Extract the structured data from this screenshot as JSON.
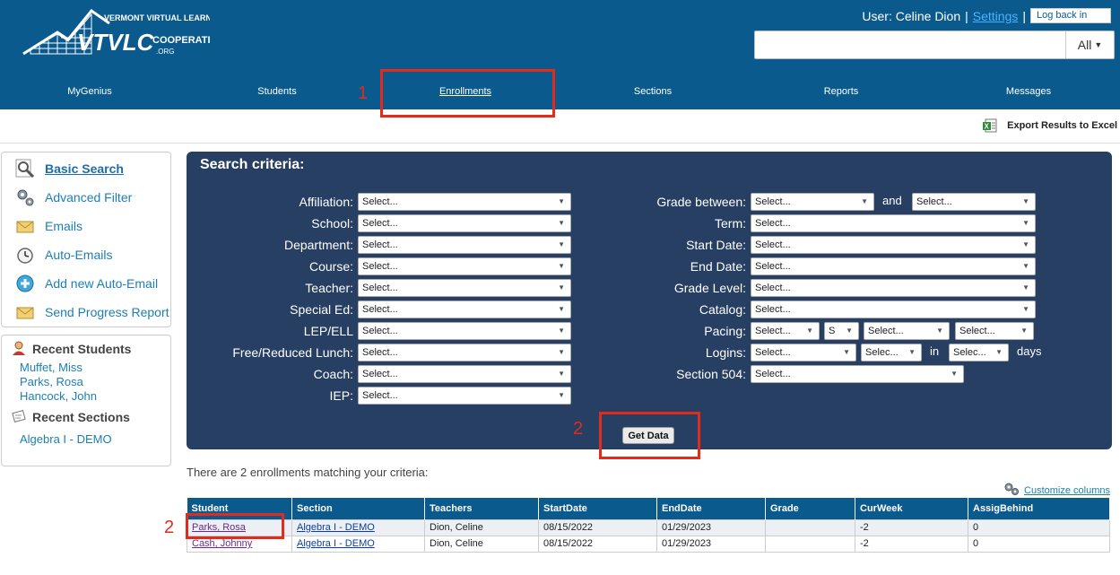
{
  "header": {
    "logo_line1": "VERMONT VIRTUAL LEARNING",
    "logo_main": "VTVLC",
    "logo_line2": "COOPERATIVE",
    "logo_line3": ".ORG",
    "user_text": "User: Celine Dion",
    "sep1": "|",
    "settings_label": "Settings",
    "sep2": "|",
    "log_back_label": "Log back in",
    "search_placeholder": "",
    "search_scope": "All"
  },
  "nav": {
    "items": [
      {
        "label": "MyGenius"
      },
      {
        "label": "Students"
      },
      {
        "label": "Enrollments"
      },
      {
        "label": "Sections"
      },
      {
        "label": "Reports"
      },
      {
        "label": "Messages"
      }
    ]
  },
  "annotations": {
    "one": "1",
    "two_a": "2",
    "two_b": "2"
  },
  "toolbar": {
    "export_label": "Export Results to Excel"
  },
  "sidebar": {
    "menu": [
      {
        "label": "Basic Search",
        "icon": "magnifier-icon"
      },
      {
        "label": "Advanced Filter",
        "icon": "gears-icon"
      },
      {
        "label": "Emails",
        "icon": "envelope-icon"
      },
      {
        "label": "Auto-Emails",
        "icon": "clock-icon"
      },
      {
        "label": "Add new Auto-Email",
        "icon": "add-icon"
      },
      {
        "label": "Send Progress Report",
        "icon": "envelope-icon"
      }
    ],
    "recent_students_title": "Recent Students",
    "recent_students": [
      "Muffet, Miss",
      "Parks, Rosa",
      "Hancock, John"
    ],
    "recent_sections_title": "Recent Sections",
    "recent_sections": [
      "Algebra I - DEMO"
    ]
  },
  "search": {
    "title": "Search criteria:",
    "left": [
      {
        "label": "Affiliation:",
        "value": "Select..."
      },
      {
        "label": "School:",
        "value": "Select..."
      },
      {
        "label": "Department:",
        "value": "Select..."
      },
      {
        "label": "Course:",
        "value": "Select..."
      },
      {
        "label": "Teacher:",
        "value": "Select..."
      },
      {
        "label": "Special Ed:",
        "value": "Select..."
      },
      {
        "label": "LEP/ELL",
        "value": "Select..."
      },
      {
        "label": "Free/Reduced Lunch:",
        "value": "Select..."
      },
      {
        "label": "Coach:",
        "value": "Select..."
      },
      {
        "label": "IEP:",
        "value": "Select..."
      }
    ],
    "grade_between_label": "Grade between:",
    "grade_from": "Select...",
    "and_label": "and",
    "grade_to": "Select...",
    "term_label": "Term:",
    "term": "Select...",
    "start_label": "Start Date:",
    "start": "Select...",
    "end_label": "End Date:",
    "end": "Select...",
    "grade_level_label": "Grade Level:",
    "grade_level": "Select...",
    "catalog_label": "Catalog:",
    "catalog": "Select...",
    "pacing_label": "Pacing:",
    "pacing_a": "Select...",
    "pacing_b": "S",
    "pacing_c": "Select...",
    "pacing_d": "Select...",
    "logins_label": "Logins:",
    "logins_a": "Select...",
    "logins_b": "Selec...",
    "in_label": "in",
    "logins_c": "Selec...",
    "days_label": "days",
    "section504_label": "Section 504:",
    "section504": "Select...",
    "get_data_label": "Get Data"
  },
  "results": {
    "summary": "There are 2 enrollments matching your criteria:",
    "customize_label": "Customize columns",
    "columns": [
      "Student",
      "Section",
      "Teachers",
      "StartDate",
      "EndDate",
      "Grade",
      "CurWeek",
      "AssigBehind"
    ],
    "rows": [
      [
        "Parks, Rosa",
        "Algebra I - DEMO",
        "Dion, Celine",
        "08/15/2022",
        "01/29/2023",
        "",
        "-2",
        "0"
      ],
      [
        "Cash, Johnny",
        "Algebra I - DEMO",
        "Dion, Celine",
        "08/15/2022",
        "01/29/2023",
        "",
        "-2",
        "0"
      ]
    ]
  },
  "colors": {
    "header_bg": "#0b5a8e",
    "panel_bg": "#273f63",
    "highlight": "#e32b1c",
    "link": "#1c7eb6"
  }
}
